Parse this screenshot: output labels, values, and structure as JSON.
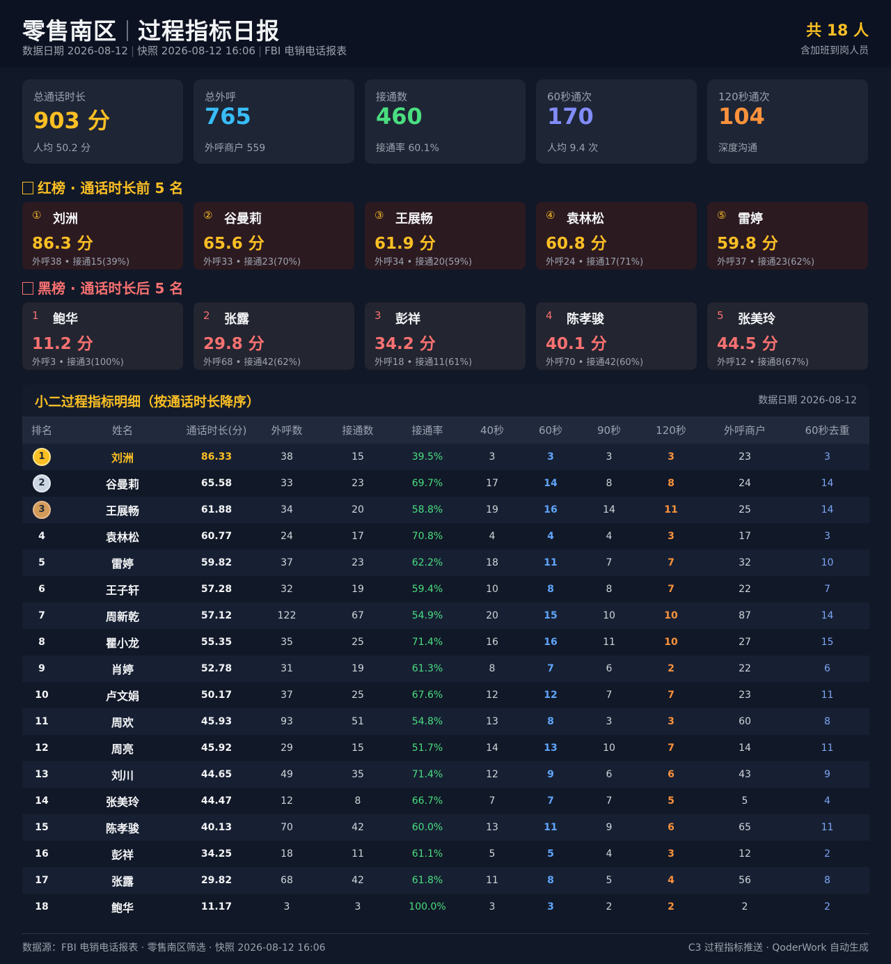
{
  "header": {
    "title_left": "零售南区",
    "title_right": "过程指标日报",
    "data_date": "数据日期 2026-08-12",
    "snapshot": "快照 2026-08-12 16:06",
    "source": "FBI 电销电话报表",
    "count": "共 18 人",
    "count_note": "含加班到岗人员"
  },
  "kpis": [
    {
      "label": "总通话时长",
      "value": "903 分",
      "sub": "人均 50.2 分",
      "color": "#fbbf24"
    },
    {
      "label": "总外呼",
      "value": "765",
      "sub": "外呼商户 559",
      "color": "#38bdf8"
    },
    {
      "label": "接通数",
      "value": "460",
      "sub": "接通率 60.1%",
      "color": "#4ade80"
    },
    {
      "label": "60秒通次",
      "value": "170",
      "sub": "人均 9.4 次",
      "color": "#818cf8"
    },
    {
      "label": "120秒通次",
      "value": "104",
      "sub": "深度沟通",
      "color": "#fb923c"
    }
  ],
  "red_board": {
    "title": "红榜 · 通话时长前 5 名",
    "color": "#fbbf24",
    "items": [
      {
        "rank": "①",
        "name": "刘洲",
        "score": "86.3 分",
        "stats": "外呼38 • 接通15(39%)"
      },
      {
        "rank": "②",
        "name": "谷曼莉",
        "score": "65.6 分",
        "stats": "外呼33 • 接通23(70%)"
      },
      {
        "rank": "③",
        "name": "王展畅",
        "score": "61.9 分",
        "stats": "外呼34 • 接通20(59%)"
      },
      {
        "rank": "④",
        "name": "袁林松",
        "score": "60.8 分",
        "stats": "外呼24 • 接通17(71%)"
      },
      {
        "rank": "⑤",
        "name": "雷婷",
        "score": "59.8 分",
        "stats": "外呼37 • 接通23(62%)"
      }
    ]
  },
  "black_board": {
    "title": "黑榜 · 通话时长后 5 名",
    "color": "#f87171",
    "items": [
      {
        "rank": "1",
        "name": "鲍华",
        "score": "11.2 分",
        "stats": "外呼3 • 接通3(100%)"
      },
      {
        "rank": "2",
        "name": "张露",
        "score": "29.8 分",
        "stats": "外呼68 • 接通42(62%)"
      },
      {
        "rank": "3",
        "name": "彭祥",
        "score": "34.2 分",
        "stats": "外呼18 • 接通11(61%)"
      },
      {
        "rank": "4",
        "name": "陈孝骏",
        "score": "40.1 分",
        "stats": "外呼70 • 接通42(60%)"
      },
      {
        "rank": "5",
        "name": "张美玲",
        "score": "44.5 分",
        "stats": "外呼12 • 接通8(67%)"
      }
    ]
  },
  "table": {
    "title": "小二过程指标明细（按通话时长降序）",
    "date": "数据日期 2026-08-12",
    "columns": [
      "排名",
      "姓名",
      "通话时长(分)",
      "外呼数",
      "接通数",
      "接通率",
      "40秒",
      "60秒",
      "90秒",
      "120秒",
      "外呼商户",
      "60秒去重"
    ],
    "rows": [
      [
        "1",
        "刘洲",
        "86.33",
        "38",
        "15",
        "39.5%",
        "3",
        "3",
        "3",
        "3",
        "23",
        "3"
      ],
      [
        "2",
        "谷曼莉",
        "65.58",
        "33",
        "23",
        "69.7%",
        "17",
        "14",
        "8",
        "8",
        "24",
        "14"
      ],
      [
        "3",
        "王展畅",
        "61.88",
        "34",
        "20",
        "58.8%",
        "19",
        "16",
        "14",
        "11",
        "25",
        "14"
      ],
      [
        "4",
        "袁林松",
        "60.77",
        "24",
        "17",
        "70.8%",
        "4",
        "4",
        "4",
        "3",
        "17",
        "3"
      ],
      [
        "5",
        "雷婷",
        "59.82",
        "37",
        "23",
        "62.2%",
        "18",
        "11",
        "7",
        "7",
        "32",
        "10"
      ],
      [
        "6",
        "王子轩",
        "57.28",
        "32",
        "19",
        "59.4%",
        "10",
        "8",
        "8",
        "7",
        "22",
        "7"
      ],
      [
        "7",
        "周新乾",
        "57.12",
        "122",
        "67",
        "54.9%",
        "20",
        "15",
        "10",
        "10",
        "87",
        "14"
      ],
      [
        "8",
        "瞿小龙",
        "55.35",
        "35",
        "25",
        "71.4%",
        "16",
        "16",
        "11",
        "10",
        "27",
        "15"
      ],
      [
        "9",
        "肖婷",
        "52.78",
        "31",
        "19",
        "61.3%",
        "8",
        "7",
        "6",
        "2",
        "22",
        "6"
      ],
      [
        "10",
        "卢文娟",
        "50.17",
        "37",
        "25",
        "67.6%",
        "12",
        "12",
        "7",
        "7",
        "23",
        "11"
      ],
      [
        "11",
        "周欢",
        "45.93",
        "93",
        "51",
        "54.8%",
        "13",
        "8",
        "3",
        "3",
        "60",
        "8"
      ],
      [
        "12",
        "周亮",
        "45.92",
        "29",
        "15",
        "51.7%",
        "14",
        "13",
        "10",
        "7",
        "14",
        "11"
      ],
      [
        "13",
        "刘川",
        "44.65",
        "49",
        "35",
        "71.4%",
        "12",
        "9",
        "6",
        "6",
        "43",
        "9"
      ],
      [
        "14",
        "张美玲",
        "44.47",
        "12",
        "8",
        "66.7%",
        "7",
        "7",
        "7",
        "5",
        "5",
        "4"
      ],
      [
        "15",
        "陈孝骏",
        "40.13",
        "70",
        "42",
        "60.0%",
        "13",
        "11",
        "9",
        "6",
        "65",
        "11"
      ],
      [
        "16",
        "彭祥",
        "34.25",
        "18",
        "11",
        "61.1%",
        "5",
        "5",
        "4",
        "3",
        "12",
        "2"
      ],
      [
        "17",
        "张露",
        "29.82",
        "68",
        "42",
        "61.8%",
        "11",
        "8",
        "5",
        "4",
        "56",
        "8"
      ],
      [
        "18",
        "鲍华",
        "11.17",
        "3",
        "3",
        "100.0%",
        "3",
        "3",
        "2",
        "2",
        "2",
        "2"
      ]
    ]
  },
  "footer": {
    "left": "数据源：FBI 电销电话报表 · 零售南区筛选 · 快照 2026-08-12 16:06",
    "right": "C3 过程指标推送 · QoderWork 自动生成"
  }
}
